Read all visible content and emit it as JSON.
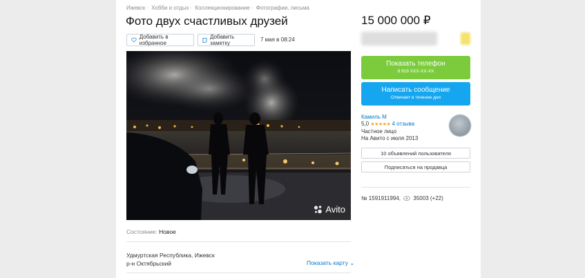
{
  "breadcrumbs": [
    "Ижевск",
    "Хобби и отдых",
    "Коллекционирование",
    "Фотографии, письма"
  ],
  "title": "Фото двух счастливых друзей",
  "actions": {
    "favorite_label": "Добавить в избранное",
    "note_label": "Добавить заметку",
    "date": "7 мая в 08:24"
  },
  "photo": {
    "watermark": "Avito"
  },
  "condition": {
    "label": "Состояние:",
    "value": "Новое"
  },
  "address": {
    "line1": "Удмуртская Республика, Ижевск",
    "line2": "р-н Октябрьский",
    "map_link": "Показать карту"
  },
  "price": "15 000 000 ₽",
  "phone_button": {
    "label": "Показать телефон",
    "sub": "8 919 XXX-XX-XX"
  },
  "message_button": {
    "label": "Написать сообщение",
    "sub": "Отвечает в течение дня"
  },
  "seller": {
    "name": "Камиль М",
    "rating": "5,0",
    "stars": "★★★★★",
    "reviews": "4 отзыва",
    "type": "Частное лицо",
    "since": "На Авито с июля 2013",
    "ads_button": "10 объявлений пользователя",
    "subscribe_button": "Подписаться на продавца"
  },
  "listing_meta": {
    "id": "№ 1591911994,",
    "views": "35003 (+22)"
  },
  "colors": {
    "green": "#7ccb3c",
    "blue": "#16a6f0",
    "link": "#0077cc",
    "star": "#f5a623"
  }
}
